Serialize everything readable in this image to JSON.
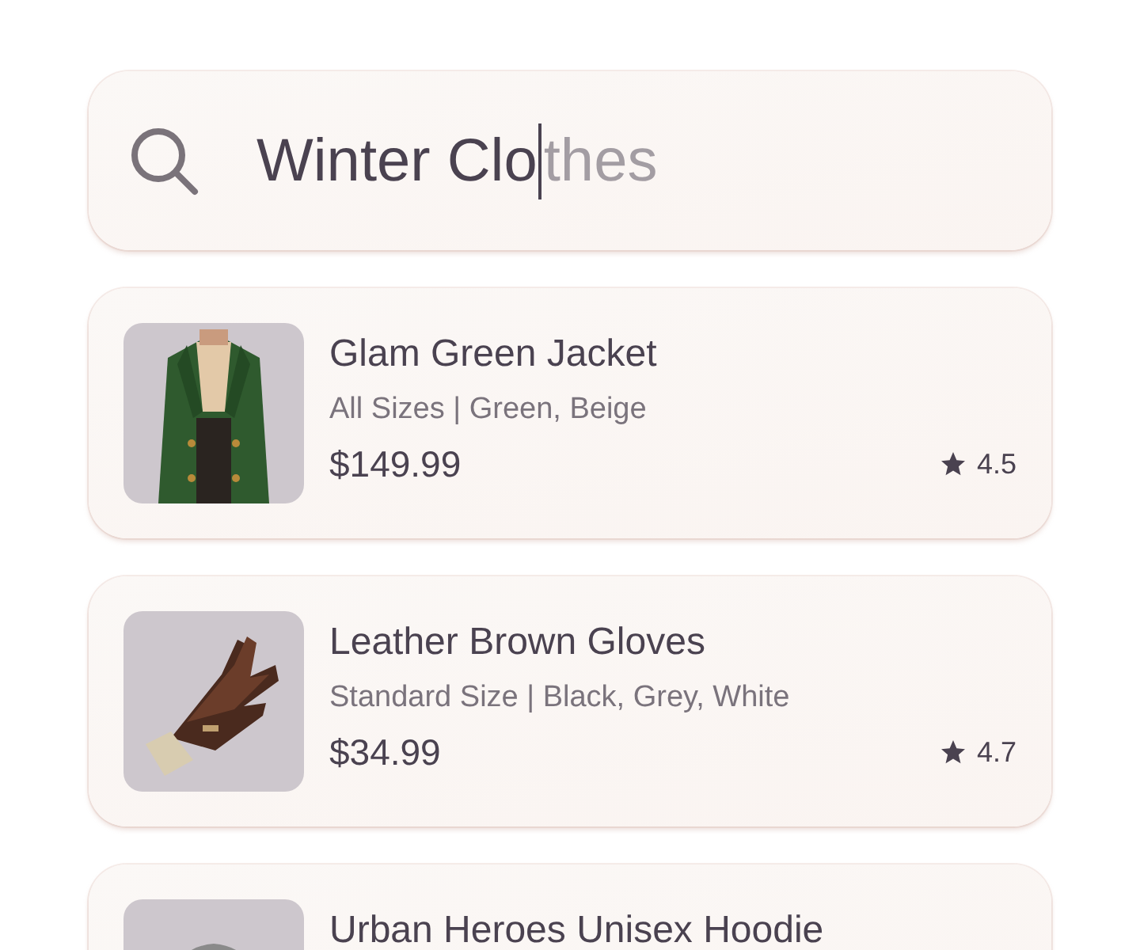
{
  "search": {
    "value": "Winter Clo",
    "suggestion": "thes"
  },
  "products": [
    {
      "name": "Glam Green Jacket",
      "details": "All Sizes | Green, Beige",
      "price": "$149.99",
      "rating": "4.5"
    },
    {
      "name": "Leather Brown Gloves",
      "details": "Standard Size | Black, Grey, White",
      "price": "$34.99",
      "rating": "4.7"
    },
    {
      "name": "Urban Heroes Unisex Hoodie"
    }
  ]
}
